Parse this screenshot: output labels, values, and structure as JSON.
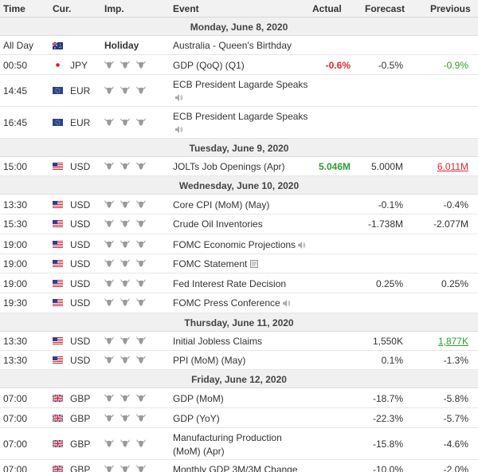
{
  "columns": {
    "time": "Time",
    "cur": "Cur.",
    "imp": "Imp.",
    "event": "Event",
    "actual": "Actual",
    "forecast": "Forecast",
    "previous": "Previous"
  },
  "days": [
    {
      "label": "Monday, June 8, 2020"
    },
    {
      "label": "Tuesday, June 9, 2020"
    },
    {
      "label": "Wednesday, June 10, 2020"
    },
    {
      "label": "Thursday, June 11, 2020"
    },
    {
      "label": "Friday, June 12, 2020"
    }
  ],
  "events": [
    {
      "time": "All Day",
      "flag": "australia-flag",
      "cur": "",
      "imp": "Holiday",
      "event": "Australia - Queen's Birthday",
      "actual": "",
      "forecast": "",
      "previous": ""
    },
    {
      "time": "00:50",
      "flag": "japan-flag",
      "cur": "JPY",
      "event": "GDP (QoQ) (Q1)",
      "actual": "-0.6%",
      "forecast": "-0.5%",
      "previous": "-0.9%"
    },
    {
      "time": "14:45",
      "flag": "eu-flag",
      "cur": "EUR",
      "event": "ECB President Lagarde Speaks",
      "actual": "",
      "forecast": "",
      "previous": ""
    },
    {
      "time": "16:45",
      "flag": "eu-flag",
      "cur": "EUR",
      "event": "ECB President Lagarde Speaks",
      "actual": "",
      "forecast": "",
      "previous": ""
    },
    {
      "time": "15:00",
      "flag": "us-flag",
      "cur": "USD",
      "event": "JOLTs Job Openings (Apr)",
      "actual": "5.046M",
      "forecast": "5.000M",
      "previous": "6.011M"
    },
    {
      "time": "13:30",
      "flag": "us-flag",
      "cur": "USD",
      "event": "Core CPI (MoM) (May)",
      "actual": "",
      "forecast": "-0.1%",
      "previous": "-0.4%"
    },
    {
      "time": "15:30",
      "flag": "us-flag",
      "cur": "USD",
      "event": "Crude Oil Inventories",
      "actual": "",
      "forecast": "-1.738M",
      "previous": "-2.077M"
    },
    {
      "time": "19:00",
      "flag": "us-flag",
      "cur": "USD",
      "event": "FOMC Economic Projections",
      "actual": "",
      "forecast": "",
      "previous": ""
    },
    {
      "time": "19:00",
      "flag": "us-flag",
      "cur": "USD",
      "event": "FOMC Statement",
      "actual": "",
      "forecast": "",
      "previous": ""
    },
    {
      "time": "19:00",
      "flag": "us-flag",
      "cur": "USD",
      "event": "Fed Interest Rate Decision",
      "actual": "",
      "forecast": "0.25%",
      "previous": "0.25%"
    },
    {
      "time": "19:30",
      "flag": "us-flag",
      "cur": "USD",
      "event": "FOMC Press Conference",
      "actual": "",
      "forecast": "",
      "previous": ""
    },
    {
      "time": "13:30",
      "flag": "us-flag",
      "cur": "USD",
      "event": "Initial Jobless Claims",
      "actual": "",
      "forecast": "1,550K",
      "previous": "1,877K"
    },
    {
      "time": "13:30",
      "flag": "us-flag",
      "cur": "USD",
      "event": "PPI (MoM) (May)",
      "actual": "",
      "forecast": "0.1%",
      "previous": "-1.3%"
    },
    {
      "time": "07:00",
      "flag": "uk-flag",
      "cur": "GBP",
      "event": "GDP (MoM)",
      "actual": "",
      "forecast": "-18.7%",
      "previous": "-5.8%"
    },
    {
      "time": "07:00",
      "flag": "uk-flag",
      "cur": "GBP",
      "event": "GDP (YoY)",
      "actual": "",
      "forecast": "-22.3%",
      "previous": "-5.7%"
    },
    {
      "time": "07:00",
      "flag": "uk-flag",
      "cur": "GBP",
      "event": "Manufacturing Production (MoM) (Apr)",
      "actual": "",
      "forecast": "-15.8%",
      "previous": "-4.6%"
    },
    {
      "time": "07:00",
      "flag": "uk-flag",
      "cur": "GBP",
      "event": "Monthly GDP 3M/3M Change",
      "actual": "",
      "forecast": "-10.0%",
      "previous": "-2.0%"
    }
  ],
  "colors": {
    "negative": "#e0262e",
    "positive": "#2ba02b",
    "bull": "#9a9a9a"
  }
}
